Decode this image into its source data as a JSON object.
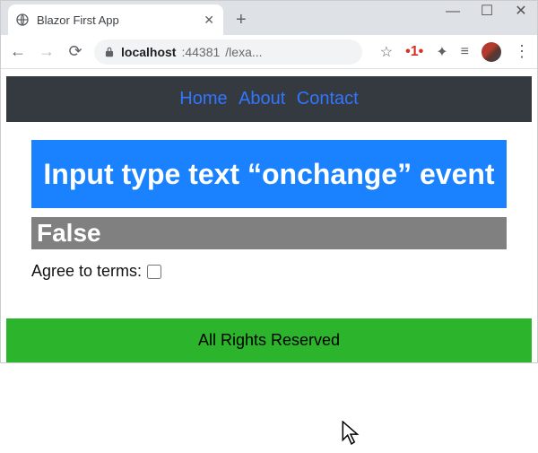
{
  "window": {
    "tab_title": "Blazor First App",
    "url_host": "localhost",
    "url_port": ":44381",
    "url_path": "/lexa..."
  },
  "nav": {
    "home": "Home",
    "about": "About",
    "contact": "Contact"
  },
  "page": {
    "heading": "Input type text “onchange” event",
    "status_value": "False",
    "checkbox_label": "Agree to terms:",
    "checkbox_checked": false
  },
  "footer": {
    "text": "All Rights Reserved"
  }
}
